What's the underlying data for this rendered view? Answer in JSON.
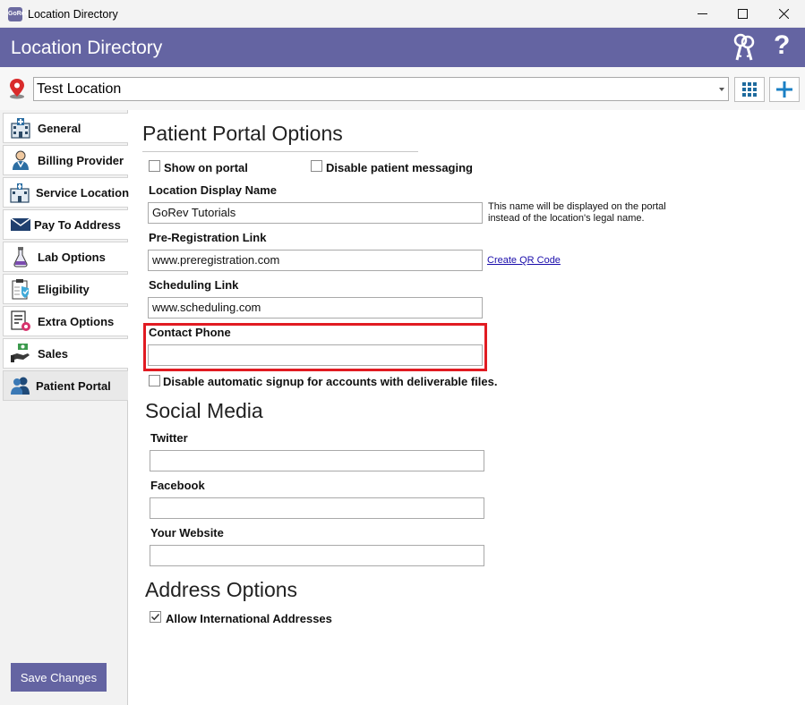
{
  "window": {
    "title": "Location Directory",
    "app_icon_text": "GoRev",
    "minimize_icon": "minimize-icon",
    "maximize_icon": "maximize-icon",
    "close_icon": "close-icon"
  },
  "header": {
    "title": "Location Directory",
    "keys_icon": "keys-icon",
    "help_label": "?"
  },
  "location": {
    "selected": "Test Location",
    "pin_icon": "map-pin-icon",
    "grid_icon": "grid-icon",
    "add_icon": "plus-icon"
  },
  "sidebar": {
    "items": [
      {
        "label": "General",
        "icon": "hospital-icon"
      },
      {
        "label": "Billing Provider",
        "icon": "doctor-icon"
      },
      {
        "label": "Service Location",
        "icon": "building-icon"
      },
      {
        "label": "Pay To Address",
        "icon": "envelope-icon"
      },
      {
        "label": "Lab Options",
        "icon": "flask-icon"
      },
      {
        "label": "Eligibility",
        "icon": "clipboard-shield-icon"
      },
      {
        "label": "Extra Options",
        "icon": "document-gear-icon"
      },
      {
        "label": "Sales",
        "icon": "money-hand-icon"
      },
      {
        "label": "Patient Portal",
        "icon": "users-icon",
        "active": true
      }
    ],
    "save_label": "Save Changes"
  },
  "portal": {
    "title": "Patient Portal Options",
    "show_on_portal": {
      "label": "Show on portal",
      "checked": false
    },
    "disable_messaging": {
      "label": "Disable patient messaging",
      "checked": false
    },
    "display_name": {
      "label": "Location Display Name",
      "value": "GoRev Tutorials"
    },
    "display_name_hint_line1": "This name will be displayed on the portal",
    "display_name_hint_line2": "instead of the location's legal name.",
    "prereg": {
      "label": "Pre-Registration Link",
      "value": "www.preregistration.com"
    },
    "qr_link": "Create QR Code",
    "scheduling": {
      "label": "Scheduling Link",
      "value": "www.scheduling.com"
    },
    "contact_phone": {
      "label": "Contact Phone",
      "value": ""
    },
    "disable_signup": {
      "label": "Disable automatic signup for accounts with deliverable files.",
      "checked": false
    }
  },
  "social": {
    "title": "Social Media",
    "twitter": {
      "label": "Twitter",
      "value": ""
    },
    "facebook": {
      "label": "Facebook",
      "value": ""
    },
    "website": {
      "label": "Your Website",
      "value": ""
    }
  },
  "address": {
    "title": "Address Options",
    "allow_international": {
      "label": "Allow International Addresses",
      "checked": true
    }
  },
  "colors": {
    "accent": "#6464a2",
    "highlight": "#e11b22",
    "link": "#1a0dab"
  }
}
